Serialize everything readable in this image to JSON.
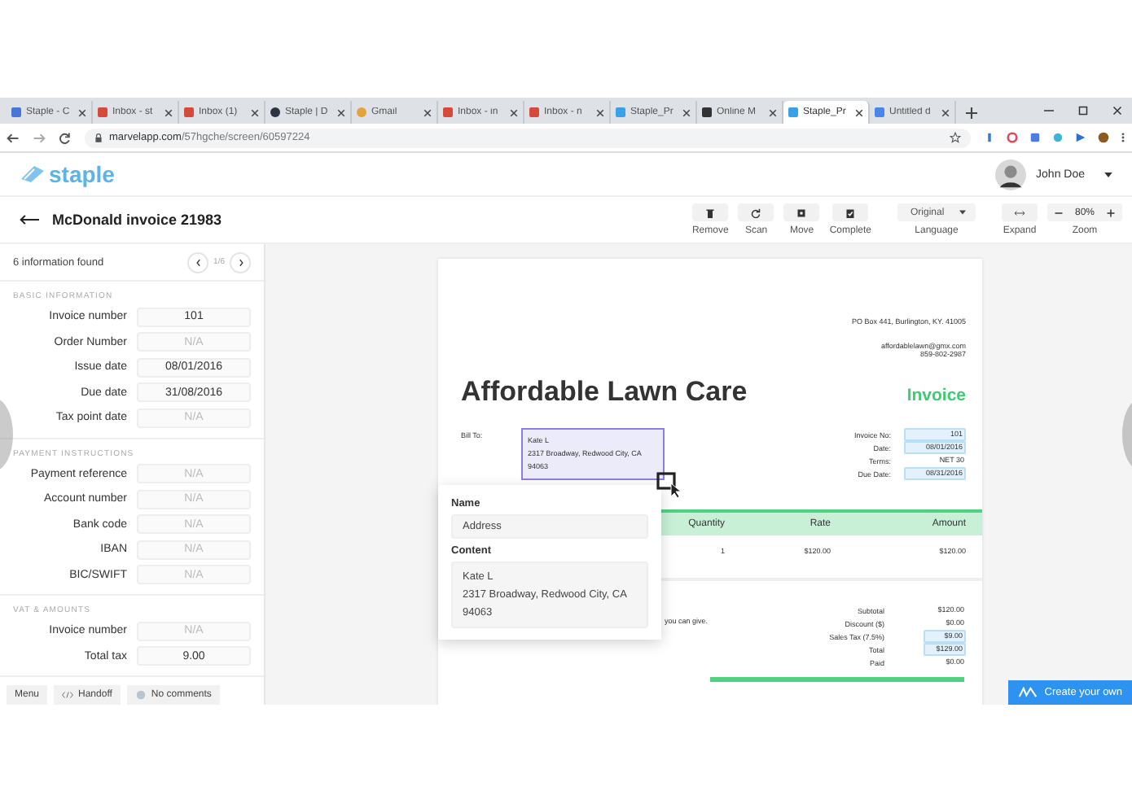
{
  "browser": {
    "tabs": [
      {
        "label": "Staple - C",
        "kind": "calendar",
        "selected": false
      },
      {
        "label": "Inbox - st",
        "kind": "mail",
        "selected": false
      },
      {
        "label": "Inbox (1)",
        "kind": "mail",
        "selected": false
      },
      {
        "label": "Staple | D",
        "kind": "dark",
        "selected": false
      },
      {
        "label": "Gmail",
        "kind": "google",
        "selected": false
      },
      {
        "label": "Inbox - in",
        "kind": "mail",
        "selected": false
      },
      {
        "label": "Inbox - n",
        "kind": "mail",
        "selected": false
      },
      {
        "label": "Staple_Pr",
        "kind": "marvel",
        "selected": false
      },
      {
        "label": "Online M",
        "kind": "square",
        "selected": false
      },
      {
        "label": "Staple_Pr",
        "kind": "marvel",
        "selected": true
      },
      {
        "label": "Untitled d",
        "kind": "doc",
        "selected": false
      }
    ],
    "url_host": "marvelapp.com",
    "url_path": "/57hgche/screen/60597224"
  },
  "app": {
    "logo": "staple",
    "user": "John Doe"
  },
  "header": {
    "title": "McDonald invoice 21983",
    "tools": [
      {
        "label": "Remove",
        "kind": "trash"
      },
      {
        "label": "Scan",
        "kind": "refresh"
      },
      {
        "label": "Move",
        "kind": "move"
      },
      {
        "label": "Complete",
        "kind": "check"
      }
    ],
    "language": {
      "value": "Original",
      "label": "Language"
    },
    "expand": {
      "label": "Expand"
    },
    "zoom": {
      "value": "80%",
      "label": "Zoom"
    }
  },
  "panel": {
    "found": "6 information found",
    "pager": "1/6",
    "sections": [
      {
        "title": "BASIC INFORMATION",
        "fields": [
          {
            "label": "Invoice number",
            "value": "101"
          },
          {
            "label": "Order Number",
            "placeholder": "N/A"
          },
          {
            "label": "Issue date",
            "value": "08/01/2016"
          },
          {
            "label": "Due date",
            "value": "31/08/2016"
          },
          {
            "label": "Tax point  date",
            "placeholder": "N/A"
          }
        ]
      },
      {
        "title": "PAYMENT INSTRUCTIONS",
        "fields": [
          {
            "label": "Payment reference",
            "placeholder": "N/A"
          },
          {
            "label": "Account number",
            "placeholder": "N/A"
          },
          {
            "label": "Bank code",
            "placeholder": "N/A"
          },
          {
            "label": "IBAN",
            "placeholder": "N/A"
          },
          {
            "label": "BIC/SWIFT",
            "placeholder": "N/A"
          }
        ]
      },
      {
        "title": "VAT & AMOUNTS",
        "fields": [
          {
            "label": "Invoice number",
            "placeholder": "N/A"
          },
          {
            "label": "Total tax",
            "value": "9.00"
          }
        ]
      }
    ]
  },
  "bottom_bar": {
    "menu": "Menu",
    "handoff": "Handoff",
    "comments": "No comments"
  },
  "invoice": {
    "address": "PO Box 441, Burlington, KY. 41005",
    "email": "affordablelawn@gmx.com",
    "phone": "859-802-2987",
    "company": "Affordable Lawn Care",
    "heading": "Invoice",
    "bill_to_label": "Bill To:",
    "bill_to": [
      "Kate L",
      "2317 Broadway, Redwood City, CA",
      "94063"
    ],
    "meta": [
      {
        "label": "Invoice No:",
        "value": "101",
        "highlighted": true
      },
      {
        "label": "Date:",
        "value": "08/01/2016",
        "highlighted": true
      },
      {
        "label": "Terms:",
        "value": "NET 30",
        "highlighted": false
      },
      {
        "label": "Due Date:",
        "value": "08/31/2016",
        "highlighted": true
      }
    ],
    "columns": [
      "Quantity",
      "Rate",
      "Amount"
    ],
    "rows": [
      [
        "1",
        "$120.00",
        "$120.00"
      ]
    ],
    "note": "you can give.",
    "totals": [
      {
        "label": "Subtotal",
        "value": "$120.00",
        "highlighted": false
      },
      {
        "label": "Discount ($)",
        "value": "$0.00",
        "highlighted": false
      },
      {
        "label": "Sales Tax (7.5%)",
        "value": "$9.00",
        "highlighted": true
      },
      {
        "label": "Total",
        "value": "$129.00",
        "highlighted": true
      },
      {
        "label": "Paid",
        "value": "$0.00",
        "highlighted": false
      }
    ]
  },
  "popover": {
    "name_label": "Name",
    "name_value": "Address",
    "content_label": "Content",
    "content": [
      "Kate L",
      "2317 Broadway, Redwood City, CA",
      "94063"
    ]
  },
  "create_button": "Create your own"
}
